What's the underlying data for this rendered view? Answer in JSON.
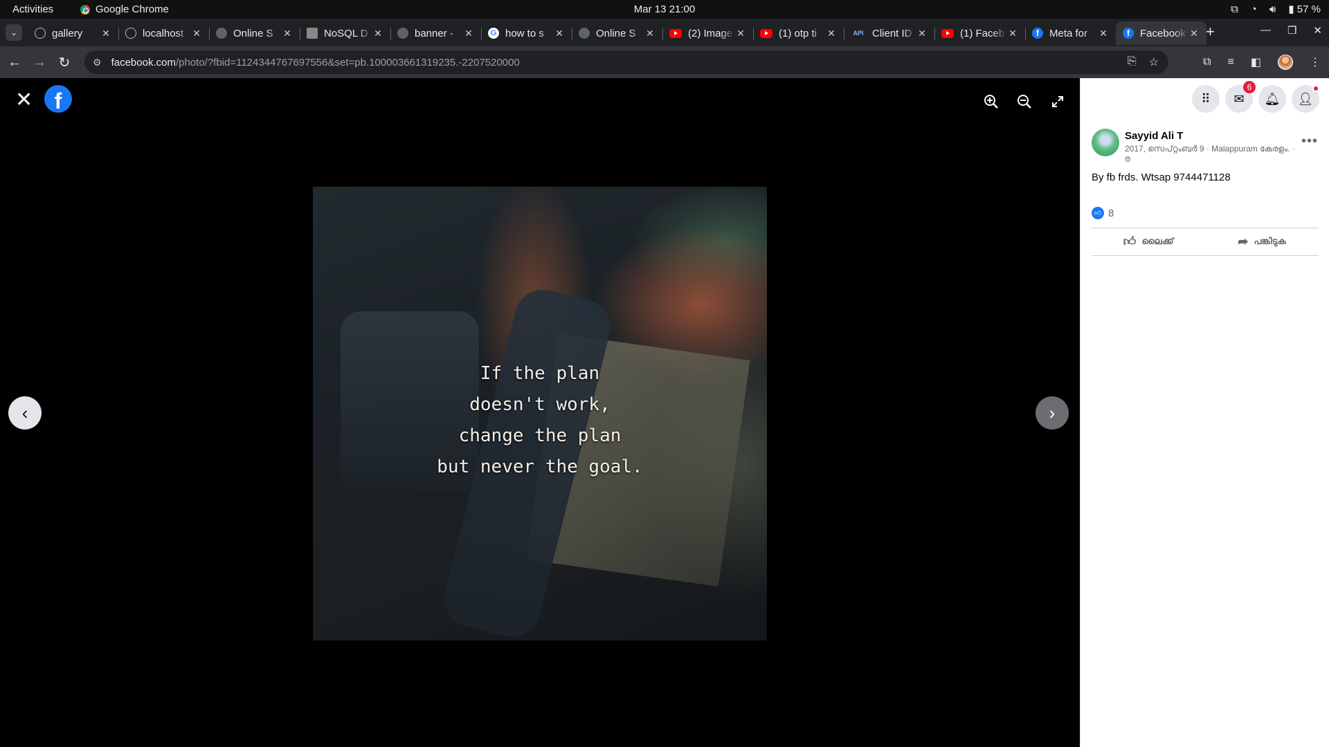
{
  "system": {
    "activities": "Activities",
    "app_name": "Google Chrome",
    "clock": "Mar 13  21:00",
    "battery": "57 %"
  },
  "tabs": [
    {
      "title": "gallery",
      "icon": "globe-icon",
      "fav": "globe"
    },
    {
      "title": "localhost",
      "icon": "globe-icon",
      "fav": "globe"
    },
    {
      "title": "Online S",
      "icon": "site-icon",
      "fav": "gray"
    },
    {
      "title": "NoSQL D",
      "icon": "doc-icon",
      "fav": "nosql"
    },
    {
      "title": "banner -",
      "icon": "site-icon",
      "fav": "gray"
    },
    {
      "title": "how to s",
      "icon": "google-icon",
      "fav": "g"
    },
    {
      "title": "Online S",
      "icon": "site-icon",
      "fav": "gray"
    },
    {
      "title": "(2) Image",
      "icon": "youtube-icon",
      "fav": "yt"
    },
    {
      "title": "(1) otp ti",
      "icon": "youtube-icon",
      "fav": "yt"
    },
    {
      "title": "Client ID",
      "icon": "api-icon",
      "fav": "api"
    },
    {
      "title": "(1) Faceb",
      "icon": "youtube-icon",
      "fav": "yt"
    },
    {
      "title": "Meta for",
      "icon": "facebook-icon",
      "fav": "fb"
    },
    {
      "title": "Facebook",
      "icon": "facebook-icon",
      "fav": "fb",
      "active": true
    }
  ],
  "address_bar": {
    "domain": "facebook.com",
    "path": "/photo/?fbid=1124344767697556&set=pb.100003661319235.-2207520000"
  },
  "photo": {
    "quote_lines": [
      "If the plan",
      "doesn't work,",
      "change the plan",
      "but never the goal."
    ]
  },
  "panel": {
    "messenger_badge": "6",
    "author": "Sayyid Ali T",
    "meta": "2017, സെപ്റ്റംബർ 9 · Malappuram കേരളം. ·",
    "post_text": "By fb frds. Wtsap 9744471128",
    "like_count": "8",
    "like_label": "ലൈക്ക്",
    "share_label": "പങ്കിടുക"
  },
  "colors": {
    "facebook_blue": "#1877f2",
    "badge_red": "#e41e3f",
    "chrome_dark": "#202124",
    "chrome_toolbar": "#35363a"
  }
}
